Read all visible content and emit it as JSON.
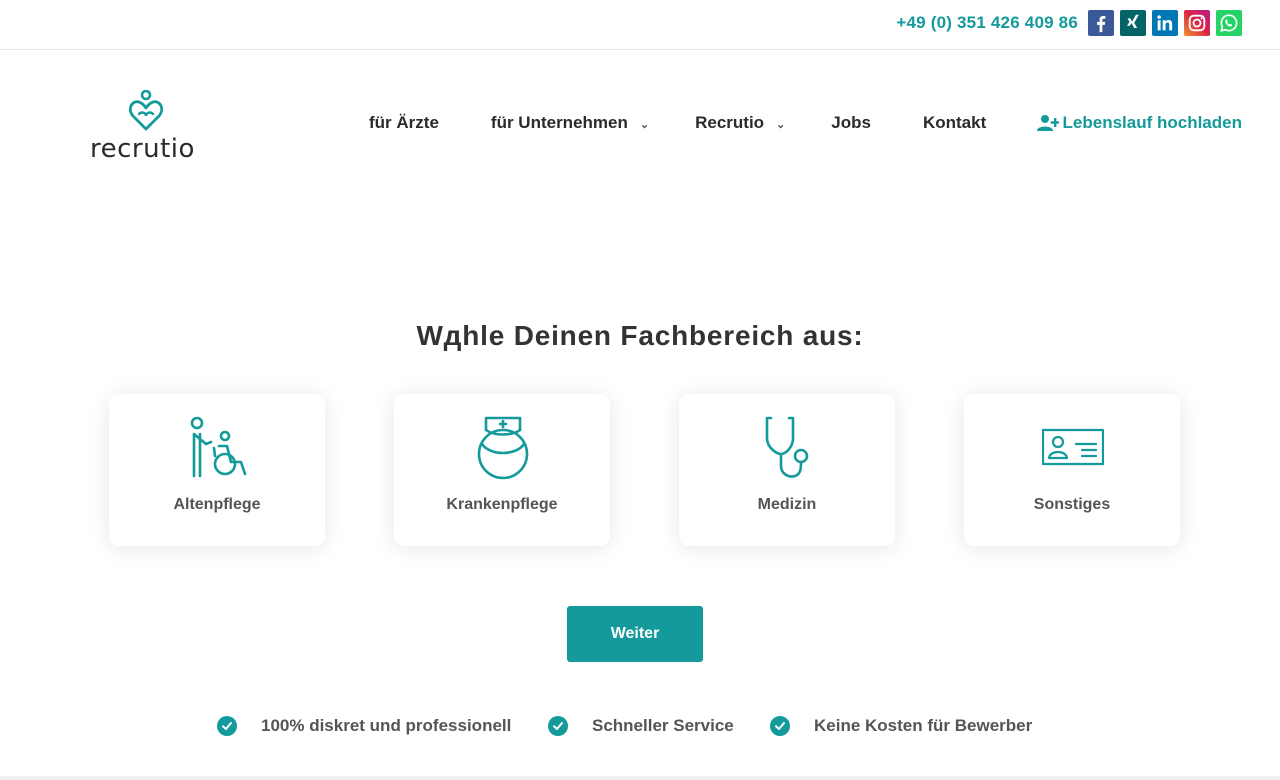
{
  "topbar": {
    "phone": "+49 (0) 351 426 409 86",
    "socials": [
      {
        "icon": "facebook-icon",
        "color": "#3b5998"
      },
      {
        "icon": "xing-icon",
        "color": "#026466"
      },
      {
        "icon": "linkedin-icon",
        "color": "#0077b5"
      },
      {
        "icon": "instagram-icon",
        "color": "#c13584"
      },
      {
        "icon": "whatsapp-icon",
        "color": "#25d366"
      }
    ]
  },
  "header": {
    "logo_text": "recrutio",
    "nav": [
      {
        "label": "für Ärzte",
        "dropdown": false
      },
      {
        "label": "für Unternehmen",
        "dropdown": true
      },
      {
        "label": "Recrutio",
        "dropdown": true
      },
      {
        "label": "Jobs",
        "dropdown": false
      },
      {
        "label": "Kontakt",
        "dropdown": false
      }
    ],
    "upload_label": "Lebenslauf hochladen",
    "chevron": "⌄"
  },
  "main": {
    "heading": "Wдhle Deinen Fachbereich aus:",
    "cards": [
      {
        "label": "Altenpflege",
        "icon": "elderly-care-icon"
      },
      {
        "label": "Krankenpflege",
        "icon": "nurse-icon"
      },
      {
        "label": "Medizin",
        "icon": "stethoscope-icon"
      },
      {
        "label": "Sonstiges",
        "icon": "id-card-icon"
      }
    ],
    "button_label": "Weiter"
  },
  "features": [
    "100% diskret und professionell",
    "Schneller Service",
    "Keine Kosten für Bewerber"
  ],
  "colors": {
    "accent": "#149a9b",
    "text": "#333333"
  }
}
